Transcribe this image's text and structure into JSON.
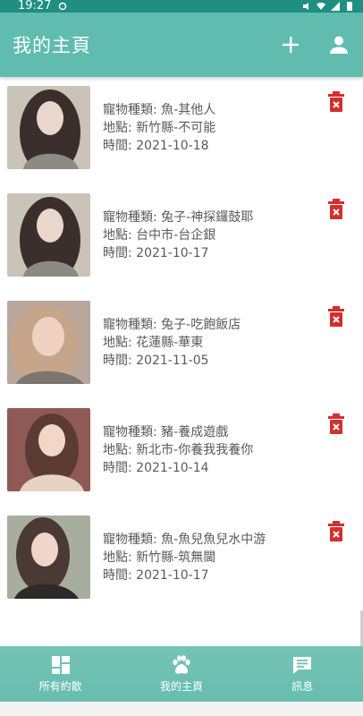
{
  "status_bar": {
    "time": "19:27"
  },
  "app_bar": {
    "title": "我的主頁",
    "add_icon": "plus-icon",
    "profile_icon": "user-icon"
  },
  "items": [
    {
      "type": "寵物種類: 魚-其他人",
      "location": "地點: 新竹縣-不可能",
      "time": "時間: 2021-10-18",
      "photo_colors": [
        "#c9c3b8",
        "#3a2f2c",
        "#e9d7cb"
      ]
    },
    {
      "type": "寵物種類: 兔子-神探鑼鼓耶",
      "location": "地點: 台中市-台企銀",
      "time": "時間: 2021-10-17",
      "photo_colors": [
        "#c9c3b8",
        "#3a2f2c",
        "#e9d7cb"
      ]
    },
    {
      "type": "寵物種類: 兔子-吃飽飯店",
      "location": "地點: 花蓮縣-華東",
      "time": "時間: 2021-11-05",
      "photo_colors": [
        "#b9a79c",
        "#c7a58a",
        "#efd3c0"
      ]
    },
    {
      "type": "寵物種類: 豬-養成遊戲",
      "location": "地點: 新北市-你養我我養你",
      "time": "時間: 2021-10-14",
      "photo_colors": [
        "#8f5a55",
        "#5b3b34",
        "#f2d6c8"
      ]
    },
    {
      "type": "寵物種類: 魚-魚兒魚兒水中游",
      "location": "地點: 新竹縣-筑無閫",
      "time": "時間: 2021-10-17",
      "photo_colors": [
        "#a7ae9f",
        "#4a3a33",
        "#efd6c8"
      ]
    }
  ],
  "colors": {
    "primary": "#60bcae",
    "status": "#1f8f82",
    "delete": "#d32f2f",
    "text": "#5a5a5a"
  },
  "bottom_nav": [
    {
      "label": "所有約散",
      "icon": "dashboard-icon"
    },
    {
      "label": "我的主頁",
      "icon": "paw-icon"
    },
    {
      "label": "訊息",
      "icon": "message-icon"
    }
  ]
}
